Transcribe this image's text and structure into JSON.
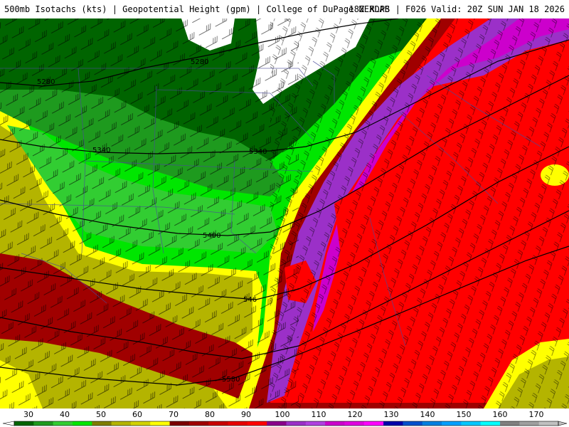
{
  "header": {
    "left": "500mb Isotachs (kts) | Geopotential Height (gpm) | College of DuPage NEXLAB",
    "right": "18Z RDPS | F026 Valid: 20Z SUN JAN 18 2026"
  },
  "contours": {
    "labels": [
      "5280",
      "5280",
      "5340",
      "5340",
      "5400",
      "546",
      "5580"
    ]
  },
  "legend": {
    "ticks": [
      "30",
      "40",
      "50",
      "60",
      "70",
      "80",
      "90",
      "100",
      "110",
      "120",
      "130",
      "140",
      "150",
      "160",
      "170"
    ],
    "colors": [
      "#006400",
      "#1e9a1e",
      "#32cd32",
      "#00e600",
      "#7e7e00",
      "#b4b400",
      "#d2d200",
      "#ffff00",
      "#7a0000",
      "#a00000",
      "#c80000",
      "#e60000",
      "#ff0000",
      "#8b008b",
      "#9b30c8",
      "#b040e0",
      "#cc00cc",
      "#e000e0",
      "#ff00ff",
      "#0000aa",
      "#0050cc",
      "#0080e0",
      "#00a0ff",
      "#00c8ff",
      "#00ffff",
      "#808080",
      "#a0a0a0",
      "#c0c0c0"
    ]
  }
}
